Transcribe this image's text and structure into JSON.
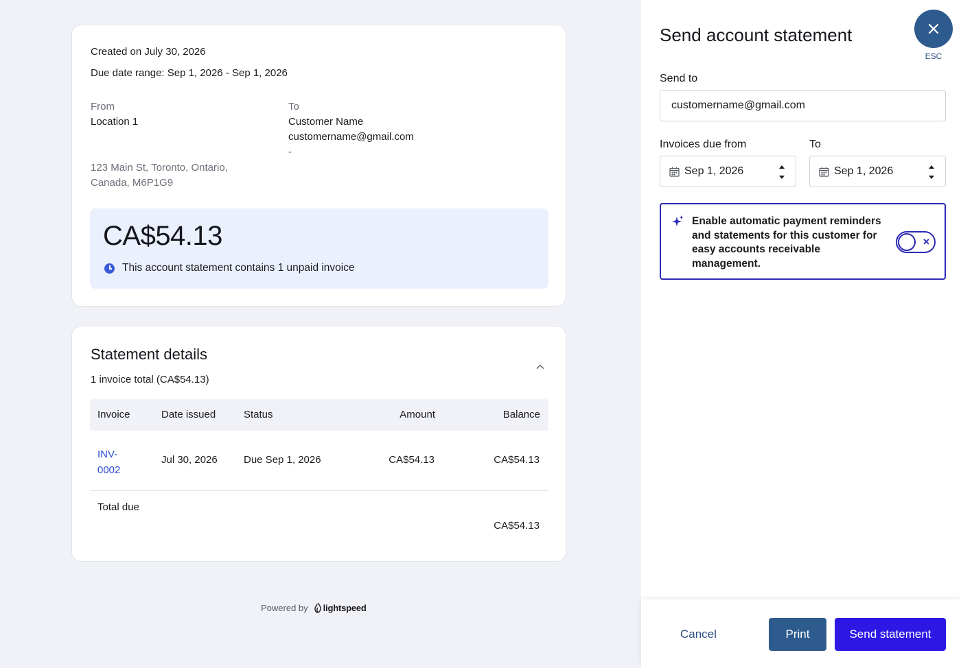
{
  "statement": {
    "created": "Created on July 30, 2026",
    "due_range": "Due date range: Sep 1, 2026 - Sep 1, 2026",
    "from_label": "From",
    "from_name": "Location 1",
    "from_address": "123 Main St, Toronto, Ontario, Canada, M6P1G9",
    "to_label": "To",
    "to_name": "Customer Name",
    "to_email": "customername@gmail.com",
    "to_extra": "-",
    "amount": "CA$54.13",
    "amount_note": "This account statement contains 1 unpaid invoice"
  },
  "details": {
    "title": "Statement details",
    "subtitle": "1 invoice total (CA$54.13)",
    "columns": [
      "Invoice",
      "Date issued",
      "Status",
      "Amount",
      "Balance"
    ],
    "rows": [
      {
        "invoice": "INV-0002",
        "date_issued": "Jul 30, 2026",
        "status": "Due Sep 1, 2026",
        "amount": "CA$54.13",
        "balance": "CA$54.13"
      }
    ],
    "total_label": "Total due",
    "total_value": "CA$54.13"
  },
  "footer": {
    "powered_by": "Powered by",
    "brand": "lightspeed"
  },
  "drawer": {
    "title": "Send account statement",
    "esc": "ESC",
    "send_to_label": "Send to",
    "send_to_value": "customername@gmail.com",
    "due_from_label": "Invoices due from",
    "due_from_value": "Sep 1, 2026",
    "to_label": "To",
    "to_value": "Sep 1, 2026",
    "reminder_text": "Enable automatic payment reminders and statements for this customer for easy accounts receivable management.",
    "toggle_on": false,
    "cancel": "Cancel",
    "print": "Print",
    "send": "Send statement"
  },
  "colors": {
    "accent": "#2c17e5",
    "secondary": "#2e5b8e",
    "link": "#2a4bd7",
    "amount_bg": "#ebf0fd",
    "reminder_border": "#2c2ab6"
  }
}
